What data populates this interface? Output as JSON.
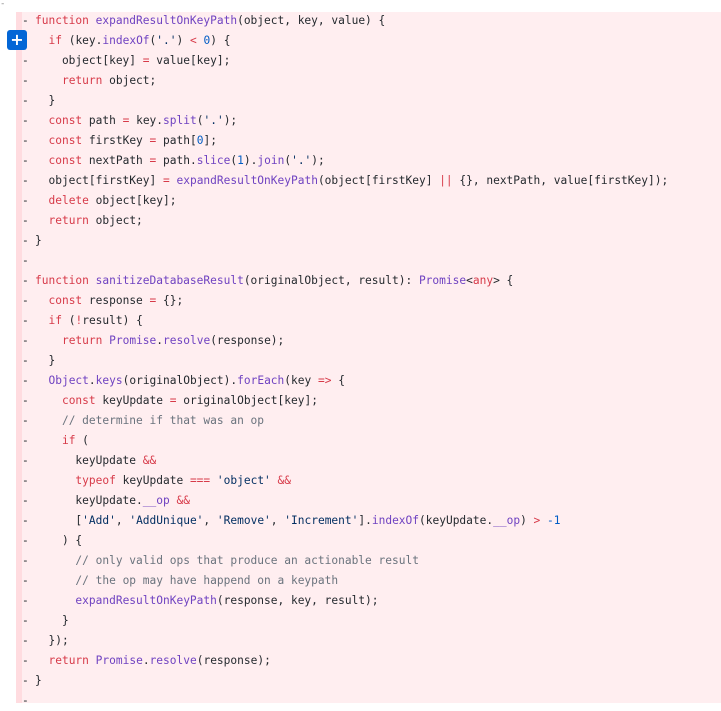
{
  "top_tick": "-",
  "add_comment_button": "+",
  "diff_marker": "-",
  "lines": [
    [
      [
        "kw",
        "function "
      ],
      [
        "fn",
        "expandResultOnKeyPath"
      ],
      [
        "p",
        "(object, key, value) {"
      ]
    ],
    [
      [
        "p",
        "  "
      ],
      [
        "kw",
        "if"
      ],
      [
        "p",
        " (key."
      ],
      [
        "fn",
        "indexOf"
      ],
      [
        "p",
        "("
      ],
      [
        "str",
        "'.'"
      ],
      [
        "p",
        ") "
      ],
      [
        "op",
        "<"
      ],
      [
        "p",
        " "
      ],
      [
        "num",
        "0"
      ],
      [
        "p",
        ") {"
      ]
    ],
    [
      [
        "p",
        "    object[key] "
      ],
      [
        "op",
        "="
      ],
      [
        "p",
        " value[key];"
      ]
    ],
    [
      [
        "p",
        "    "
      ],
      [
        "kw",
        "return"
      ],
      [
        "p",
        " object;"
      ]
    ],
    [
      [
        "p",
        "  }"
      ]
    ],
    [
      [
        "p",
        "  "
      ],
      [
        "kw",
        "const"
      ],
      [
        "p",
        " path "
      ],
      [
        "op",
        "="
      ],
      [
        "p",
        " key."
      ],
      [
        "fn",
        "split"
      ],
      [
        "p",
        "("
      ],
      [
        "str",
        "'.'"
      ],
      [
        "p",
        ");"
      ]
    ],
    [
      [
        "p",
        "  "
      ],
      [
        "kw",
        "const"
      ],
      [
        "p",
        " firstKey "
      ],
      [
        "op",
        "="
      ],
      [
        "p",
        " path["
      ],
      [
        "num",
        "0"
      ],
      [
        "p",
        "];"
      ]
    ],
    [
      [
        "p",
        "  "
      ],
      [
        "kw",
        "const"
      ],
      [
        "p",
        " nextPath "
      ],
      [
        "op",
        "="
      ],
      [
        "p",
        " path."
      ],
      [
        "fn",
        "slice"
      ],
      [
        "p",
        "("
      ],
      [
        "num",
        "1"
      ],
      [
        "p",
        ")."
      ],
      [
        "fn",
        "join"
      ],
      [
        "p",
        "("
      ],
      [
        "str",
        "'.'"
      ],
      [
        "p",
        ");"
      ]
    ],
    [
      [
        "p",
        "  object[firstKey] "
      ],
      [
        "op",
        "="
      ],
      [
        "p",
        " "
      ],
      [
        "fn",
        "expandResultOnKeyPath"
      ],
      [
        "p",
        "(object[firstKey] "
      ],
      [
        "op",
        "||"
      ],
      [
        "p",
        " {}, nextPath, value[firstKey]);"
      ]
    ],
    [
      [
        "p",
        "  "
      ],
      [
        "kw",
        "delete"
      ],
      [
        "p",
        " object[key];"
      ]
    ],
    [
      [
        "p",
        "  "
      ],
      [
        "kw",
        "return"
      ],
      [
        "p",
        " object;"
      ]
    ],
    [
      [
        "p",
        "}"
      ]
    ],
    [],
    [
      [
        "kw",
        "function "
      ],
      [
        "fn",
        "sanitizeDatabaseResult"
      ],
      [
        "p",
        "(originalObject, result): "
      ],
      [
        "fn",
        "Promise"
      ],
      [
        "p",
        "<"
      ],
      [
        "kw",
        "any"
      ],
      [
        "p",
        "> {"
      ]
    ],
    [
      [
        "p",
        "  "
      ],
      [
        "kw",
        "const"
      ],
      [
        "p",
        " response "
      ],
      [
        "op",
        "="
      ],
      [
        "p",
        " {};"
      ]
    ],
    [
      [
        "p",
        "  "
      ],
      [
        "kw",
        "if"
      ],
      [
        "p",
        " ("
      ],
      [
        "op",
        "!"
      ],
      [
        "p",
        "result) {"
      ]
    ],
    [
      [
        "p",
        "    "
      ],
      [
        "kw",
        "return"
      ],
      [
        "p",
        " "
      ],
      [
        "fn",
        "Promise"
      ],
      [
        "p",
        "."
      ],
      [
        "fn",
        "resolve"
      ],
      [
        "p",
        "(response);"
      ]
    ],
    [
      [
        "p",
        "  }"
      ]
    ],
    [
      [
        "p",
        "  "
      ],
      [
        "fn",
        "Object"
      ],
      [
        "p",
        "."
      ],
      [
        "fn",
        "keys"
      ],
      [
        "p",
        "(originalObject)."
      ],
      [
        "fn",
        "forEach"
      ],
      [
        "p",
        "(key "
      ],
      [
        "kw",
        "=>"
      ],
      [
        "p",
        " {"
      ]
    ],
    [
      [
        "p",
        "    "
      ],
      [
        "kw",
        "const"
      ],
      [
        "p",
        " keyUpdate "
      ],
      [
        "op",
        "="
      ],
      [
        "p",
        " originalObject[key];"
      ]
    ],
    [
      [
        "p",
        "    "
      ],
      [
        "cm",
        "// determine if that was an op"
      ]
    ],
    [
      [
        "p",
        "    "
      ],
      [
        "kw",
        "if"
      ],
      [
        "p",
        " ("
      ]
    ],
    [
      [
        "p",
        "      keyUpdate "
      ],
      [
        "op",
        "&&"
      ]
    ],
    [
      [
        "p",
        "      "
      ],
      [
        "kw",
        "typeof"
      ],
      [
        "p",
        " keyUpdate "
      ],
      [
        "op",
        "==="
      ],
      [
        "p",
        " "
      ],
      [
        "str",
        "'object'"
      ],
      [
        "p",
        " "
      ],
      [
        "op",
        "&&"
      ]
    ],
    [
      [
        "p",
        "      keyUpdate."
      ],
      [
        "fn",
        "__op"
      ],
      [
        "p",
        " "
      ],
      [
        "op",
        "&&"
      ]
    ],
    [
      [
        "p",
        "      ["
      ],
      [
        "str",
        "'Add'"
      ],
      [
        "p",
        ", "
      ],
      [
        "str",
        "'AddUnique'"
      ],
      [
        "p",
        ", "
      ],
      [
        "str",
        "'Remove'"
      ],
      [
        "p",
        ", "
      ],
      [
        "str",
        "'Increment'"
      ],
      [
        "p",
        "]."
      ],
      [
        "fn",
        "indexOf"
      ],
      [
        "p",
        "(keyUpdate."
      ],
      [
        "fn",
        "__op"
      ],
      [
        "p",
        ") "
      ],
      [
        "op",
        ">"
      ],
      [
        "p",
        " "
      ],
      [
        "num",
        "-1"
      ]
    ],
    [
      [
        "p",
        "    ) {"
      ]
    ],
    [
      [
        "p",
        "      "
      ],
      [
        "cm",
        "// only valid ops that produce an actionable result"
      ]
    ],
    [
      [
        "p",
        "      "
      ],
      [
        "cm",
        "// the op may have happend on a keypath"
      ]
    ],
    [
      [
        "p",
        "      "
      ],
      [
        "fn",
        "expandResultOnKeyPath"
      ],
      [
        "p",
        "(response, key, result);"
      ]
    ],
    [
      [
        "p",
        "    }"
      ]
    ],
    [
      [
        "p",
        "  });"
      ]
    ],
    [
      [
        "p",
        "  "
      ],
      [
        "kw",
        "return"
      ],
      [
        "p",
        " "
      ],
      [
        "fn",
        "Promise"
      ],
      [
        "p",
        "."
      ],
      [
        "fn",
        "resolve"
      ],
      [
        "p",
        "(response);"
      ]
    ],
    [
      [
        "p",
        "}"
      ]
    ],
    []
  ],
  "colors": {
    "deleted_line_bg": "#ffeef0",
    "deleted_marker_bg": "#ffdce0",
    "keyword": "#d73a49",
    "function": "#6f42c1",
    "string": "#032f62",
    "number": "#005cc5",
    "comment": "#6a737d",
    "text": "#24292e",
    "add_button": "#0366d6"
  }
}
